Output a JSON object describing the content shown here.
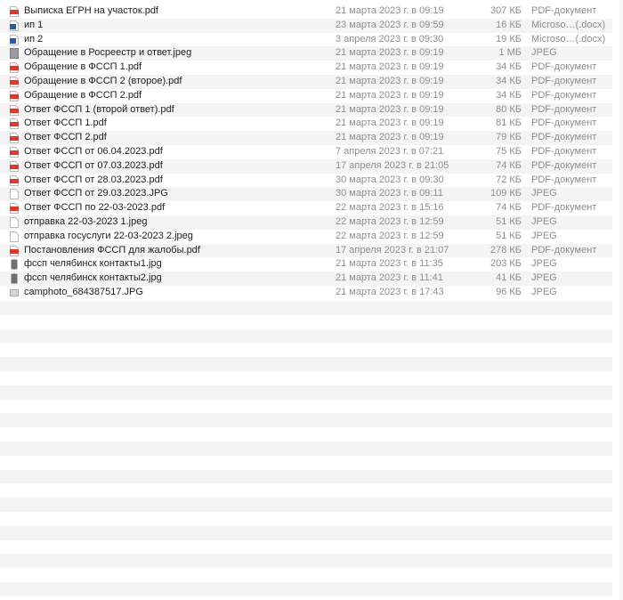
{
  "files": [
    {
      "icon": "pdf-icon",
      "name": "Выписка ЕГРН на участок.pdf",
      "date": "21 марта 2023 г. в 09:19",
      "size": "307 КБ",
      "kind": "PDF-документ"
    },
    {
      "icon": "word-icon",
      "name": "ип 1",
      "date": "23 марта 2023 г. в 09:59",
      "size": "16 КБ",
      "kind": "Microso…(.docx)"
    },
    {
      "icon": "word-icon",
      "name": "ип 2",
      "date": "3 апреля 2023 г. в 09:30",
      "size": "19 КБ",
      "kind": "Microso…(.docx)"
    },
    {
      "icon": "image-icon",
      "name": "Обращение в Росреестр и ответ.jpeg",
      "date": "21 марта 2023 г. в 09:19",
      "size": "1 МБ",
      "kind": "JPEG"
    },
    {
      "icon": "pdf-icon",
      "name": "Обращение в ФССП 1.pdf",
      "date": "21 марта 2023 г. в 09:19",
      "size": "34 КБ",
      "kind": "PDF-документ"
    },
    {
      "icon": "pdf-icon",
      "name": "Обращение в ФССП 2 (второе).pdf",
      "date": "21 марта 2023 г. в 09:19",
      "size": "34 КБ",
      "kind": "PDF-документ"
    },
    {
      "icon": "pdf-icon",
      "name": "Обращение в ФССП 2.pdf",
      "date": "21 марта 2023 г. в 09:19",
      "size": "34 КБ",
      "kind": "PDF-документ"
    },
    {
      "icon": "pdf-icon",
      "name": "Ответ ФССП 1 (второй ответ).pdf",
      "date": "21 марта 2023 г. в 09:19",
      "size": "80 КБ",
      "kind": "PDF-документ"
    },
    {
      "icon": "pdf-icon",
      "name": "Ответ ФССП 1.pdf",
      "date": "21 марта 2023 г. в 09:19",
      "size": "81 КБ",
      "kind": "PDF-документ"
    },
    {
      "icon": "pdf-icon",
      "name": "Ответ ФССП 2.pdf",
      "date": "21 марта 2023 г. в 09:19",
      "size": "79 КБ",
      "kind": "PDF-документ"
    },
    {
      "icon": "pdf-icon",
      "name": "Ответ ФССП от 06.04.2023.pdf",
      "date": "7 апреля 2023 г. в 07:21",
      "size": "75 КБ",
      "kind": "PDF-документ"
    },
    {
      "icon": "pdf-icon",
      "name": "Ответ ФССП от 07.03.2023.pdf",
      "date": "17 апреля 2023 г. в 21:05",
      "size": "74 КБ",
      "kind": "PDF-документ"
    },
    {
      "icon": "pdf-icon",
      "name": "Ответ ФССП от 28.03.2023.pdf",
      "date": "30 марта 2023 г. в 09:30",
      "size": "72 КБ",
      "kind": "PDF-документ"
    },
    {
      "icon": "doc-blank-icon",
      "name": "Ответ ФССП от 29.03.2023.JPG",
      "date": "30 марта 2023 г. в 09:11",
      "size": "109 КБ",
      "kind": "JPEG"
    },
    {
      "icon": "pdf-icon",
      "name": "Ответ ФССП по 22-03-2023.pdf",
      "date": "22 марта 2023 г. в 15:16",
      "size": "74 КБ",
      "kind": "PDF-документ"
    },
    {
      "icon": "doc-blank-icon",
      "name": "отправка 22-03-2023 1.jpeg",
      "date": "22 марта 2023 г. в 12:59",
      "size": "51 КБ",
      "kind": "JPEG"
    },
    {
      "icon": "doc-blank-icon",
      "name": "отправка госуслуги 22-03-2023 2.jpeg",
      "date": "22 марта 2023 г. в 12:59",
      "size": "51 КБ",
      "kind": "JPEG"
    },
    {
      "icon": "pdf-icon",
      "name": "Постановления ФССП для жалобы.pdf",
      "date": "17 апреля 2023 г. в 21:07",
      "size": "278 КБ",
      "kind": "PDF-документ"
    },
    {
      "icon": "phone-image-icon",
      "name": "фссп челябинск контакты1.jpg",
      "date": "21 марта 2023 г. в 11:35",
      "size": "203 КБ",
      "kind": "JPEG"
    },
    {
      "icon": "phone-image-icon",
      "name": "фссп челябинск контакты2.jpg",
      "date": "21 марта 2023 г. в 11:41",
      "size": "41 КБ",
      "kind": "JPEG"
    },
    {
      "icon": "photo-icon",
      "name": "camphoto_684387517.JPG",
      "date": "21 марта 2023 г. в 17:43",
      "size": "96 КБ",
      "kind": "JPEG"
    }
  ],
  "colors": {
    "pdf_icon": "#d9382e",
    "word_icon": "#2b5aa8",
    "alt_row": "#f4f4f5",
    "secondary_text": "#8e8e93"
  }
}
